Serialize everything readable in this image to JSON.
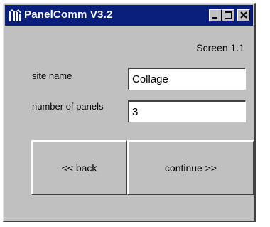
{
  "window": {
    "title": "PanelComm V3.2",
    "app_icon": "panelcomm-logo-icon",
    "controls": [
      "minimize-icon",
      "maximize-icon",
      "close-icon"
    ],
    "titlebar_color": "#0a1e7c"
  },
  "screen": {
    "label": "Screen 1.1"
  },
  "form": {
    "site_name": {
      "label": "site name",
      "value": "Collage"
    },
    "panels": {
      "label": "number of panels",
      "value": "3"
    }
  },
  "buttons": {
    "back": "<< back",
    "continue": "continue >>"
  }
}
